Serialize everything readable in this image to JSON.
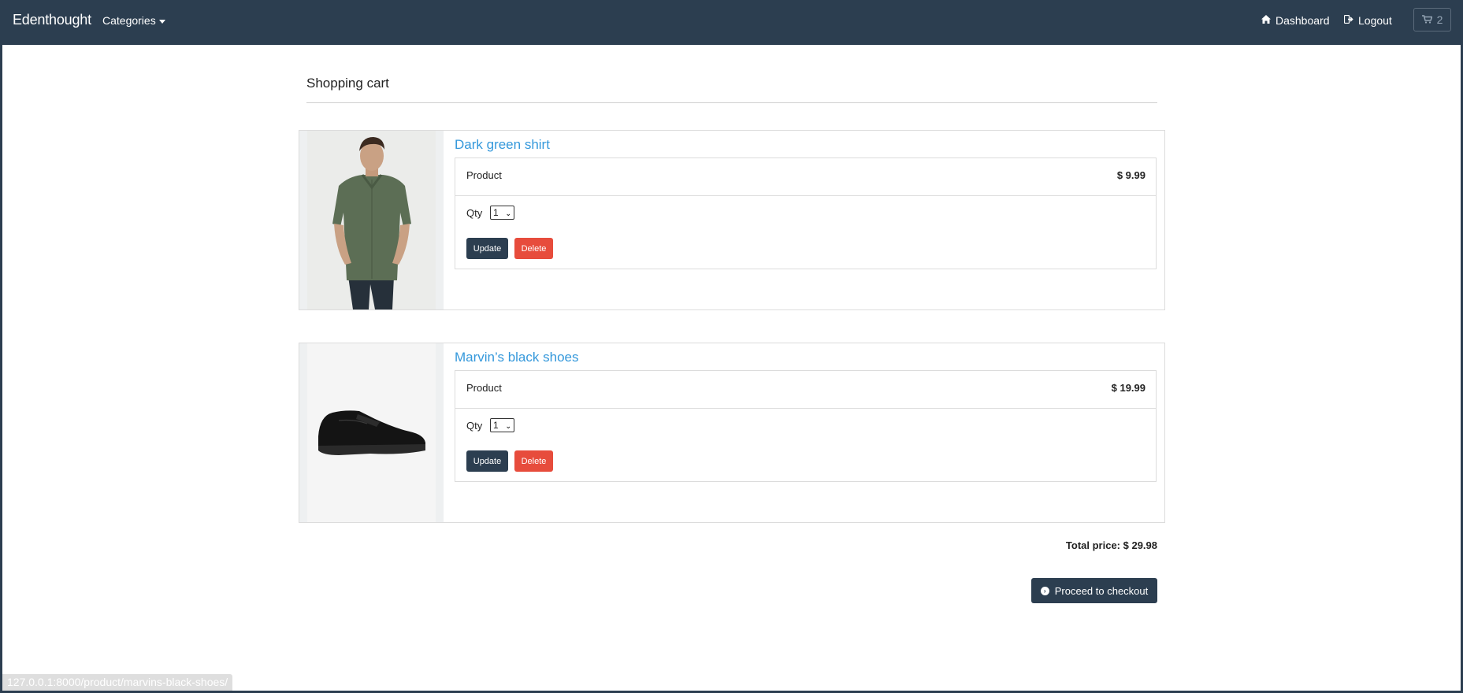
{
  "navbar": {
    "brand": "Edenthought",
    "categories_label": "Categories",
    "dashboard_label": "Dashboard",
    "logout_label": "Logout",
    "cart_count": "2"
  },
  "page": {
    "title": "Shopping cart"
  },
  "cart_items": [
    {
      "name": "Dark green shirt",
      "product_label": "Product",
      "price": "$ 9.99",
      "qty_label": "Qty",
      "qty_value": "1",
      "update_label": "Update",
      "delete_label": "Delete"
    },
    {
      "name": "Marvin’s black shoes",
      "product_label": "Product",
      "price": "$ 19.99",
      "qty_label": "Qty",
      "qty_value": "1",
      "update_label": "Update",
      "delete_label": "Delete"
    }
  ],
  "summary": {
    "total_price": "Total price: $ 29.98",
    "checkout_label": "Proceed to checkout"
  },
  "status_bar": {
    "url": "127.0.0.1:8000/product/marvins-black-shoes/"
  },
  "colors": {
    "navbar": "#2c3e50",
    "link": "#3498db",
    "danger": "#e74c3c"
  }
}
